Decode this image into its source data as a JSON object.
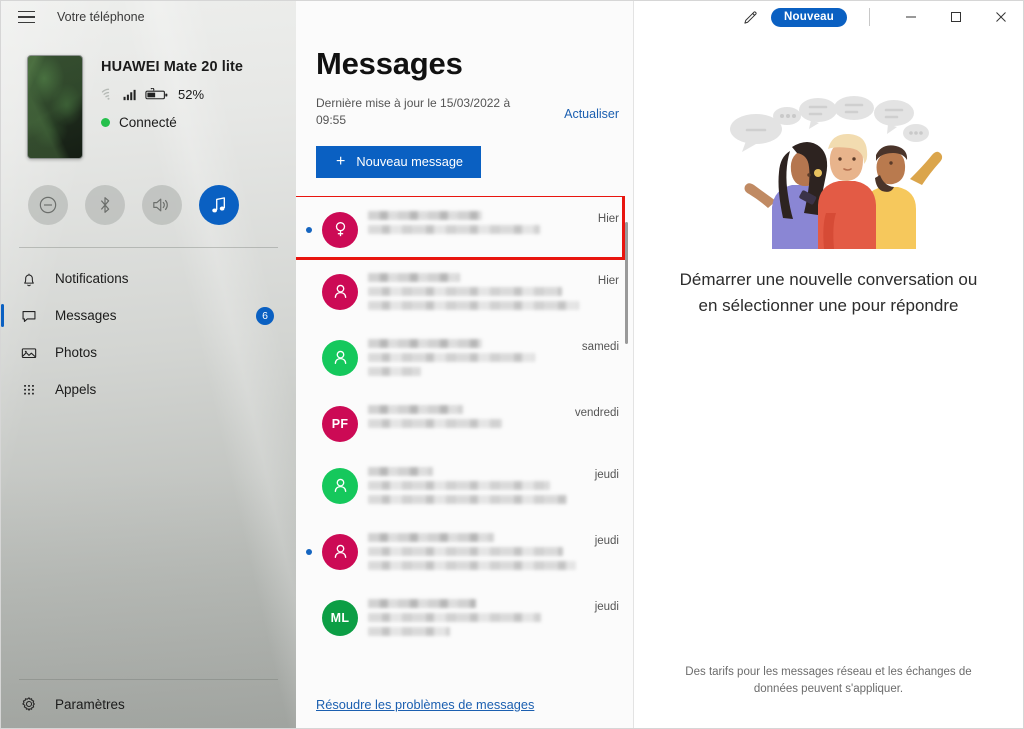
{
  "window": {
    "title": "Votre téléphone",
    "pen_icon": "pen-edit-icon",
    "new_badge": "Nouveau",
    "minimize": "—",
    "maximize": "□",
    "close": "✕"
  },
  "device": {
    "name": "HUAWEI Mate 20 lite",
    "battery": "52%",
    "status": "Connecté",
    "wifi_icon": "wifi-icon",
    "signal_icon": "cellular-signal-icon",
    "battery_icon": "battery-icon"
  },
  "quick_actions": [
    {
      "name": "do-not-disturb",
      "icon": "minus-circle-icon",
      "active": false
    },
    {
      "name": "bluetooth",
      "icon": "bluetooth-icon",
      "active": false
    },
    {
      "name": "volume",
      "icon": "speaker-icon",
      "active": false
    },
    {
      "name": "media",
      "icon": "music-note-icon",
      "active": true
    }
  ],
  "sidebar": {
    "items": [
      {
        "label": "Notifications",
        "icon": "bell-icon",
        "selected": false,
        "badge": ""
      },
      {
        "label": "Messages",
        "icon": "chat-bubble-icon",
        "selected": true,
        "badge": "6"
      },
      {
        "label": "Photos",
        "icon": "photo-icon",
        "selected": false,
        "badge": ""
      },
      {
        "label": "Appels",
        "icon": "dialpad-icon",
        "selected": false,
        "badge": ""
      }
    ],
    "settings": {
      "label": "Paramètres",
      "icon": "gear-icon"
    }
  },
  "messages": {
    "title": "Messages",
    "last_update": "Dernière mise à jour le 15/03/2022 à 09:55",
    "refresh_label": "Actualiser",
    "new_message_label": "Nouveau message",
    "new_message_plus": "+",
    "troubleshoot_label": "Résoudre les problèmes de messages",
    "conversations": [
      {
        "time": "Hier",
        "avatar_color": "#cc0a55",
        "initials": "",
        "avatar_glyph": "female-symbol",
        "unread": true,
        "lines": 2,
        "highlighted": true
      },
      {
        "time": "Hier",
        "avatar_color": "#cc0a55",
        "initials": "",
        "avatar_glyph": "person",
        "unread": false,
        "lines": 3,
        "highlighted": false
      },
      {
        "time": "samedi",
        "avatar_color": "#15c85c",
        "initials": "",
        "avatar_glyph": "person",
        "unread": false,
        "lines": 3,
        "highlighted": false
      },
      {
        "time": "vendredi",
        "avatar_color": "#cc0a55",
        "initials": "PF",
        "avatar_glyph": "",
        "unread": false,
        "lines": 2,
        "highlighted": false
      },
      {
        "time": "jeudi",
        "avatar_color": "#15c85c",
        "initials": "",
        "avatar_glyph": "person",
        "unread": false,
        "lines": 3,
        "highlighted": false
      },
      {
        "time": "jeudi",
        "avatar_color": "#cc0a55",
        "initials": "",
        "avatar_glyph": "person",
        "unread": true,
        "lines": 3,
        "highlighted": false
      },
      {
        "time": "jeudi",
        "avatar_color": "#0c9e45",
        "initials": "ML",
        "avatar_glyph": "",
        "unread": false,
        "lines": 3,
        "highlighted": false
      }
    ]
  },
  "empty_state": {
    "text": "Démarrer une nouvelle conversation ou en sélectionner une pour répondre",
    "illustration": "three-people-chatting-illustration"
  },
  "footer": {
    "note": "Des tarifs pour les messages réseau et les échanges de données peuvent s'appliquer."
  },
  "colors": {
    "accent": "#0a60c2",
    "link": "#1b5fb0",
    "annotation": "#e8150f",
    "avatar_crimson": "#cc0a55",
    "avatar_green": "#15c85c",
    "connected_dot": "#25c04c"
  }
}
